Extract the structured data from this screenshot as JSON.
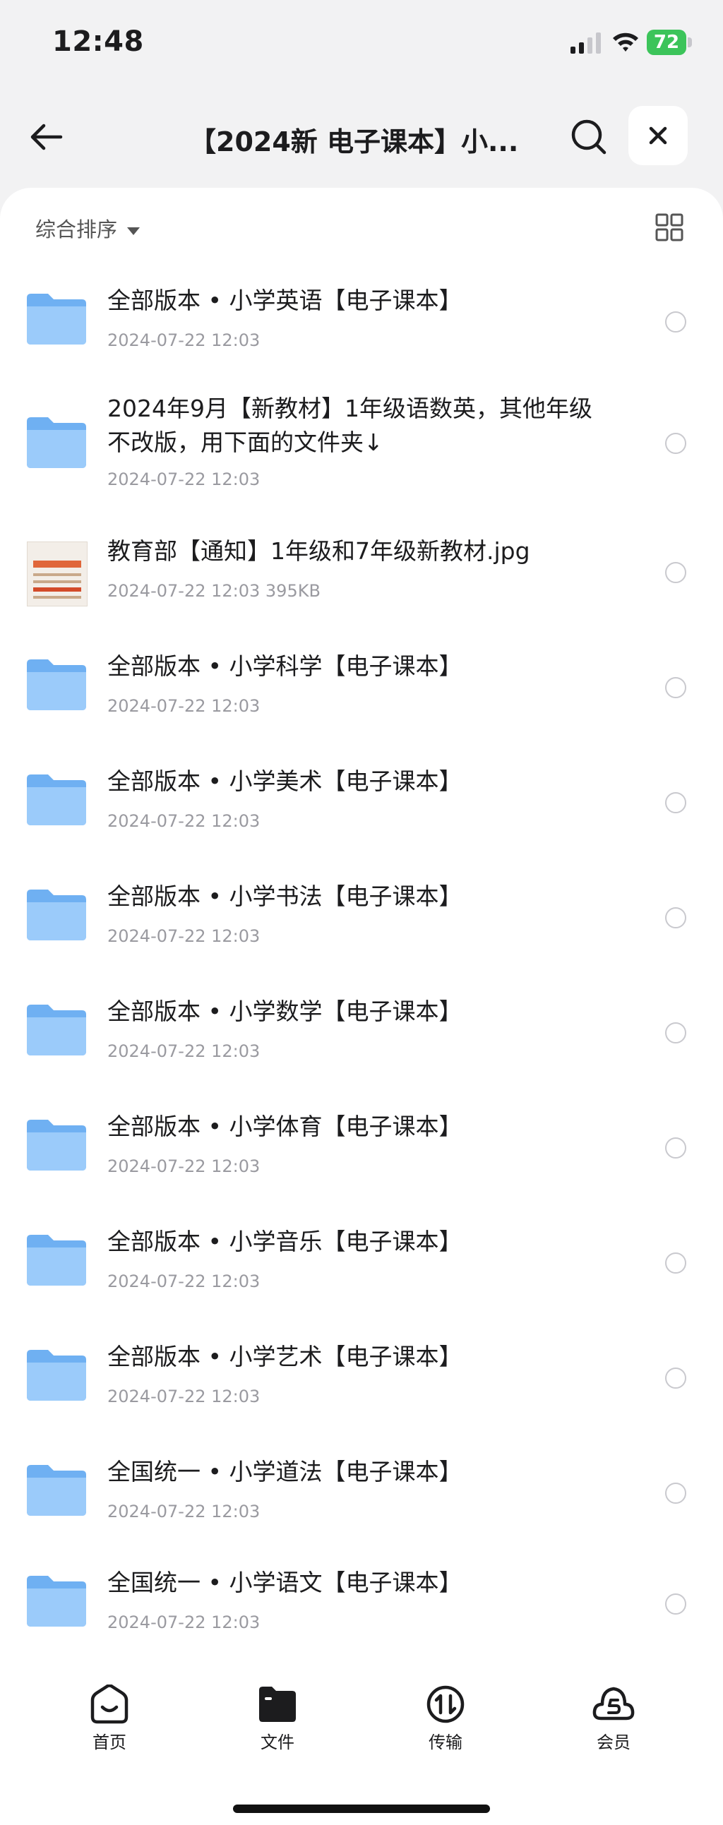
{
  "status": {
    "time": "12:48",
    "battery": "72"
  },
  "nav": {
    "title": "【2024新 电子课本】小...",
    "back_icon": "arrow-left-icon",
    "search_icon": "search-icon",
    "close_icon": "close-icon"
  },
  "toolbar": {
    "sort_label": "综合排序",
    "view_icon": "grid-view-icon"
  },
  "files": [
    {
      "type": "folder",
      "name": "全部版本 • 小学英语【电子课本】",
      "meta": "2024-07-22 12:03"
    },
    {
      "type": "folder",
      "name": "2024年9月【新教材】1年级语数英，其他年级不改版，用下面的文件夹↓",
      "meta": "2024-07-22 12:03"
    },
    {
      "type": "image",
      "name": "教育部【通知】1年级和7年级新教材.jpg",
      "meta": "2024-07-22 12:03  395KB"
    },
    {
      "type": "folder",
      "name": "全部版本 • 小学科学【电子课本】",
      "meta": "2024-07-22 12:03"
    },
    {
      "type": "folder",
      "name": "全部版本 • 小学美术【电子课本】",
      "meta": "2024-07-22 12:03"
    },
    {
      "type": "folder",
      "name": "全部版本 • 小学书法【电子课本】",
      "meta": "2024-07-22 12:03"
    },
    {
      "type": "folder",
      "name": "全部版本 • 小学数学【电子课本】",
      "meta": "2024-07-22 12:03"
    },
    {
      "type": "folder",
      "name": "全部版本 • 小学体育【电子课本】",
      "meta": "2024-07-22 12:03"
    },
    {
      "type": "folder",
      "name": "全部版本 • 小学音乐【电子课本】",
      "meta": "2024-07-22 12:03"
    },
    {
      "type": "folder",
      "name": "全部版本 • 小学艺术【电子课本】",
      "meta": "2024-07-22 12:03"
    },
    {
      "type": "folder",
      "name": "全国统一 • 小学道法【电子课本】",
      "meta": "2024-07-22 12:03"
    },
    {
      "type": "folder",
      "name": "全国统一 • 小学语文【电子课本】",
      "meta": "2024-07-22 12:03"
    }
  ],
  "tabs": [
    {
      "label": "首页",
      "icon": "home-icon"
    },
    {
      "label": "文件",
      "icon": "folder-icon"
    },
    {
      "label": "传输",
      "icon": "transfer-icon"
    },
    {
      "label": "会员",
      "icon": "member-icon"
    }
  ],
  "colors": {
    "folder": "#7fbaf5",
    "battery": "#3cc45a"
  }
}
